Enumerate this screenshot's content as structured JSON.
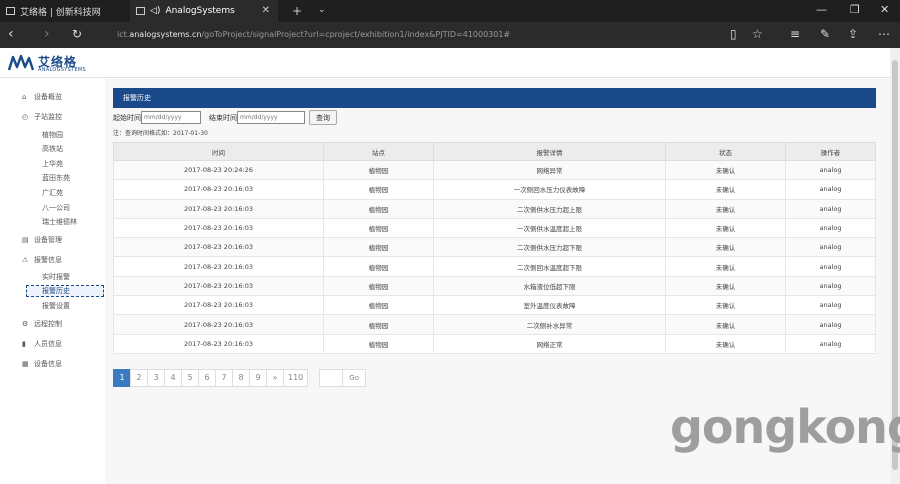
{
  "browser": {
    "tabs": [
      {
        "title": "艾络格 | 创新科技网"
      },
      {
        "title": "AnalogSystems",
        "sound": "◁)"
      }
    ],
    "url_prefix": "ict.",
    "url_domain": "analogsystems.cn",
    "url_rest": "/goToProject/signalProject?url=cproject/exhibition1/index&PJTID=41000301#"
  },
  "logo": {
    "cn": "艾络格",
    "en": "ANALOGSYSTEMS"
  },
  "sidebar": {
    "items": [
      {
        "label": "设备概览",
        "icon": "home-icon"
      },
      {
        "label": "子站监控",
        "icon": "monitor-icon"
      },
      {
        "label": "设备管理",
        "icon": "folder-icon"
      },
      {
        "label": "报警信息",
        "icon": "warning-icon"
      },
      {
        "label": "远程控制",
        "icon": "gear-icon"
      },
      {
        "label": "人员信息",
        "icon": "bookmark-icon"
      },
      {
        "label": "设备信息",
        "icon": "list-icon"
      }
    ],
    "monitor_subitems": [
      "植物园",
      "高铁站",
      "上华苑",
      "蓝田东苑",
      "广汇苑",
      "八一公司",
      "瑞士维德林"
    ],
    "alarm_subitems": [
      "实时报警",
      "报警历史",
      "报警设置"
    ],
    "active": "报警历史"
  },
  "panel": {
    "title": "报警历史",
    "start_label": "起始时间",
    "end_label": "结束时间",
    "start_placeholder": "mm/dd/yyyy",
    "end_placeholder": "mm/dd/yyyy",
    "query_button": "查询",
    "note": "注：查询时间格式如：2017-01-30"
  },
  "table": {
    "headers": [
      "时间",
      "站点",
      "报警详情",
      "状态",
      "操作者"
    ],
    "rows": [
      [
        "2017-08-23 20:24:26",
        "植物园",
        "网络异常",
        "未确认",
        "analog"
      ],
      [
        "2017-08-23 20:16:03",
        "植物园",
        "一次侧回水压力仪表故障",
        "未确认",
        "analog"
      ],
      [
        "2017-08-23 20:16:03",
        "植物园",
        "二次侧供水压力超上限",
        "未确认",
        "analog"
      ],
      [
        "2017-08-23 20:16:03",
        "植物园",
        "一次侧供水温度超上限",
        "未确认",
        "analog"
      ],
      [
        "2017-08-23 20:16:03",
        "植物园",
        "二次侧供水压力超下限",
        "未确认",
        "analog"
      ],
      [
        "2017-08-23 20:16:03",
        "植物园",
        "二次侧回水温度超下限",
        "未确认",
        "analog"
      ],
      [
        "2017-08-23 20:16:03",
        "植物园",
        "水箱液位低超下限",
        "未确认",
        "analog"
      ],
      [
        "2017-08-23 20:16:03",
        "植物园",
        "室外温度仪表故障",
        "未确认",
        "analog"
      ],
      [
        "2017-08-23 20:16:03",
        "植物园",
        "二次侧补水异常",
        "未确认",
        "analog"
      ],
      [
        "2017-08-23 20:16:03",
        "植物园",
        "网络正常",
        "未确认",
        "analog"
      ]
    ]
  },
  "pager": {
    "pages": [
      "1",
      "2",
      "3",
      "4",
      "5",
      "6",
      "7",
      "8",
      "9",
      "»",
      "110"
    ],
    "active": "1",
    "go_label": "Go"
  },
  "watermark": "gongkong",
  "colors": {
    "brand": "#1a4a8a",
    "pager_active": "#3a7bc1"
  }
}
